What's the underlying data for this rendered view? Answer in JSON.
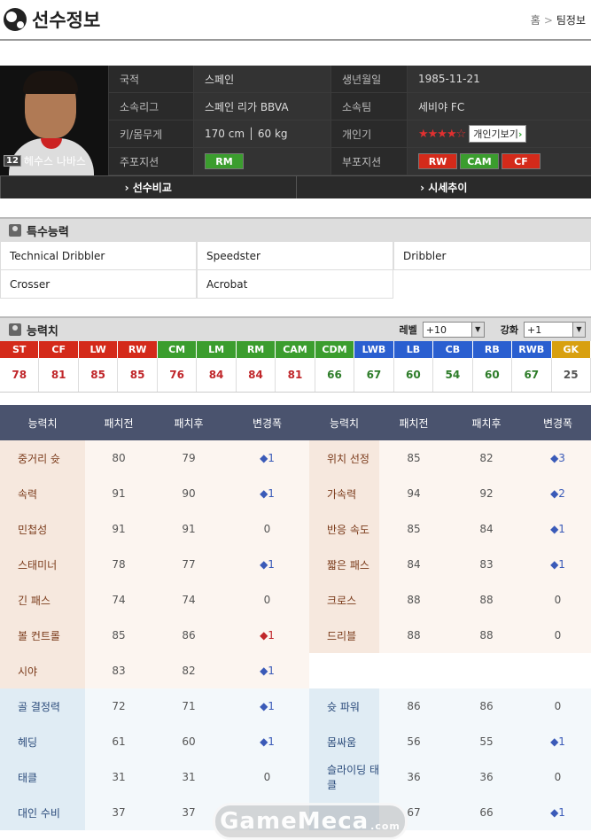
{
  "header": {
    "title": "선수정보",
    "breadcrumb": [
      "홈",
      "팀정보"
    ]
  },
  "player": {
    "number": "12",
    "name": "헤수스 나바스",
    "info": [
      {
        "k1": "국적",
        "v1": "스페인",
        "k2": "생년월일",
        "v2": "1985-11-21"
      },
      {
        "k1": "소속리그",
        "v1": "스페인 리가 BBVA",
        "k2": "소속팀",
        "v2": "세비야 FC"
      },
      {
        "k1": "키/몸무게",
        "v1": "170 cm │ 60 kg",
        "k2": "개인기",
        "v2": "★★★★☆"
      },
      {
        "k1": "주포지션",
        "v1": "",
        "k2": "부포지션",
        "v2": ""
      }
    ],
    "skill_button": "개인기보기",
    "main_position": "RM",
    "sub_positions": [
      "RW",
      "CAM",
      "CF"
    ]
  },
  "nav": {
    "compare": "› 선수비교",
    "trend": "› 시세추이"
  },
  "special": {
    "title": "특수능력",
    "items": [
      "Technical Dribbler",
      "Speedster",
      "Dribbler",
      "Crosser",
      "Acrobat",
      ""
    ]
  },
  "ability": {
    "title": "능력치",
    "level_label": "레벨",
    "level_value": "+10",
    "enhance_label": "강화",
    "enhance_value": "+1",
    "positions": [
      {
        "p": "ST",
        "v": "78",
        "c": "#d42a1a",
        "t": "#c0262a"
      },
      {
        "p": "CF",
        "v": "81",
        "c": "#d42a1a",
        "t": "#c0262a"
      },
      {
        "p": "LW",
        "v": "85",
        "c": "#d42a1a",
        "t": "#c0262a"
      },
      {
        "p": "RW",
        "v": "85",
        "c": "#d42a1a",
        "t": "#c0262a"
      },
      {
        "p": "CM",
        "v": "76",
        "c": "#3b9d2e",
        "t": "#c0262a"
      },
      {
        "p": "LM",
        "v": "84",
        "c": "#3b9d2e",
        "t": "#c0262a"
      },
      {
        "p": "RM",
        "v": "84",
        "c": "#3b9d2e",
        "t": "#c0262a"
      },
      {
        "p": "CAM",
        "v": "81",
        "c": "#3b9d2e",
        "t": "#c0262a"
      },
      {
        "p": "CDM",
        "v": "66",
        "c": "#3b9d2e",
        "t": "#2e7d2a"
      },
      {
        "p": "LWB",
        "v": "67",
        "c": "#2a5fd0",
        "t": "#2e7d2a"
      },
      {
        "p": "LB",
        "v": "60",
        "c": "#2a5fd0",
        "t": "#2e7d2a"
      },
      {
        "p": "CB",
        "v": "54",
        "c": "#2a5fd0",
        "t": "#2e7d2a"
      },
      {
        "p": "RB",
        "v": "60",
        "c": "#2a5fd0",
        "t": "#2e7d2a"
      },
      {
        "p": "RWB",
        "v": "67",
        "c": "#2a5fd0",
        "t": "#2e7d2a"
      },
      {
        "p": "GK",
        "v": "25",
        "c": "#d8a010",
        "t": "#555555"
      }
    ]
  },
  "stats": {
    "headers": [
      "능력치",
      "패치전",
      "패치후",
      "변경폭",
      "능력치",
      "패치전",
      "패치후",
      "변경폭"
    ],
    "rows": [
      {
        "t": "warm",
        "a": [
          "중거리 슛",
          "80",
          "79",
          "◆1",
          "위치 선정",
          "85",
          "82",
          "◆3"
        ],
        "d1": "up",
        "d2": "up"
      },
      {
        "t": "warm",
        "a": [
          "속력",
          "91",
          "90",
          "◆1",
          "가속력",
          "94",
          "92",
          "◆2"
        ],
        "d1": "up",
        "d2": "up"
      },
      {
        "t": "warm",
        "a": [
          "민첩성",
          "91",
          "91",
          "0",
          "반응 속도",
          "85",
          "84",
          "◆1"
        ],
        "d1": "",
        "d2": "up"
      },
      {
        "t": "warm",
        "a": [
          "스태미너",
          "78",
          "77",
          "◆1",
          "짧은 패스",
          "84",
          "83",
          "◆1"
        ],
        "d1": "up",
        "d2": "up"
      },
      {
        "t": "warm",
        "a": [
          "긴 패스",
          "74",
          "74",
          "0",
          "크로스",
          "88",
          "88",
          "0"
        ],
        "d1": "",
        "d2": ""
      },
      {
        "t": "warm",
        "a": [
          "볼 컨트롤",
          "85",
          "86",
          "◆1",
          "드리블",
          "88",
          "88",
          "0"
        ],
        "d1": "dn",
        "d2": ""
      },
      {
        "t": "warm",
        "a": [
          "시야",
          "83",
          "82",
          "◆1",
          "",
          "",
          "",
          ""
        ],
        "d1": "up",
        "d2": "blank"
      },
      {
        "t": "cool",
        "a": [
          "골 결정력",
          "72",
          "71",
          "◆1",
          "슛 파워",
          "86",
          "86",
          "0"
        ],
        "d1": "up",
        "d2": ""
      },
      {
        "t": "cool",
        "a": [
          "헤딩",
          "61",
          "60",
          "◆1",
          "몸싸움",
          "56",
          "55",
          "◆1"
        ],
        "d1": "up",
        "d2": "up"
      },
      {
        "t": "cool",
        "a": [
          "태클",
          "31",
          "31",
          "0",
          "슬라이딩 태클",
          "36",
          "36",
          "0"
        ],
        "d1": "",
        "d2": ""
      },
      {
        "t": "cool",
        "a": [
          "대인 수비",
          "37",
          "37",
          "",
          "",
          "67",
          "66",
          "◆1"
        ],
        "d1": "",
        "d2": "up"
      }
    ]
  },
  "watermark": "GameMeca",
  "watermark_suffix": ".com"
}
